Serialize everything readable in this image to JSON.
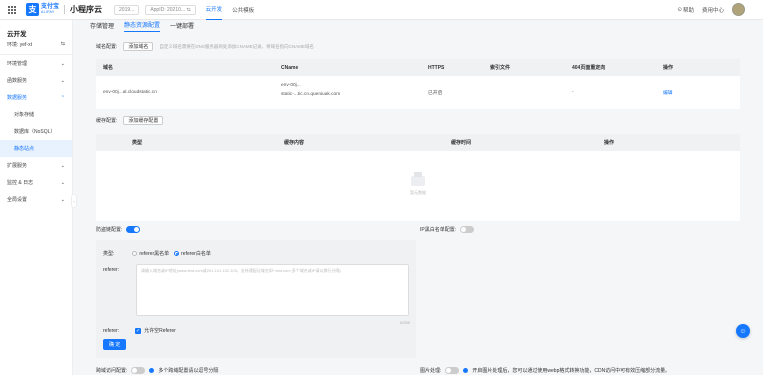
{
  "topbar": {
    "logo_cn": "支付宝",
    "logo_en": "ALIPAY",
    "app_title": "小程序云",
    "project_pill": "2019...",
    "appid_pill": "AppID: 20210... ⇆",
    "tabs": [
      "云开发",
      "公共模板"
    ],
    "help": "帮助",
    "notify": "费用中心"
  },
  "sidebar": {
    "title": "云开发",
    "env_label": "环境: yef-xt",
    "env_switch": "⇆",
    "items": [
      {
        "label": "环境管理",
        "arrow": "⌄"
      },
      {
        "label": "函数服务",
        "arrow": "⌄"
      },
      {
        "label": "数据服务",
        "arrow": "⌃"
      },
      {
        "label": "扩展服务",
        "arrow": "⌄"
      },
      {
        "label": "监控 & 日志",
        "arrow": "⌄"
      },
      {
        "label": "全局设置",
        "arrow": "⌄"
      }
    ],
    "subitems": [
      "对象存储",
      "数据库（NoSQL）",
      "静态站点"
    ]
  },
  "subtabs": [
    "存储管理",
    "静态资源配置",
    "一键部署"
  ],
  "domain": {
    "label": "域名配置:",
    "button": "添加域名",
    "hint": "自定义域名需要在DNS服务器商处添加CNAME记录，将域名指向CNAME域名",
    "columns": [
      "域名",
      "CName",
      "HTTPS",
      "索引文件",
      "404页面重定向",
      "操作"
    ],
    "row": {
      "domain": "env-00j...al.cloudstatic.cn",
      "cname_1": "env-00j...",
      "cname_2": "static-...tic.cn.queniuak.com",
      "https": "已开启",
      "index": "",
      "redirect": "-",
      "action": "编辑"
    }
  },
  "cache": {
    "label": "缓存配置:",
    "button": "添加缓存配置",
    "columns": [
      "类型",
      "缓存内容",
      "缓存时间",
      "操作"
    ],
    "empty": "暂无数据"
  },
  "anti_leech": {
    "label": "防盗链配置:",
    "enabled": true
  },
  "ip_whitelist": {
    "label": "IP黑白名单配置:",
    "enabled": false
  },
  "referer": {
    "type_label": "类型:",
    "options": [
      "referer黑名单",
      "referer白名单"
    ],
    "selected": 1,
    "ref_label": "referer:",
    "placeholder": "请输入域名或IP地址(www.test.com或201.101.102.103，支持通配泛域名如*.test.com,多个域名或IP请以换行分隔)",
    "count": "0/200",
    "allow_empty": "允许空Referer",
    "confirm": "确 定"
  },
  "cross_domain": {
    "label": "跨域访问配置:",
    "enabled": false,
    "hint": "多个跨域配置请以逗号分隔"
  },
  "image_processing": {
    "label": "图片处理:",
    "enabled": false,
    "hint": "开启图片处理后，您可以通过使用webp格式转换功能，CDN访问中可有效压缩部分流量。"
  },
  "colors": {
    "accent": "#1677ff",
    "panel": "#f0f1f3"
  }
}
